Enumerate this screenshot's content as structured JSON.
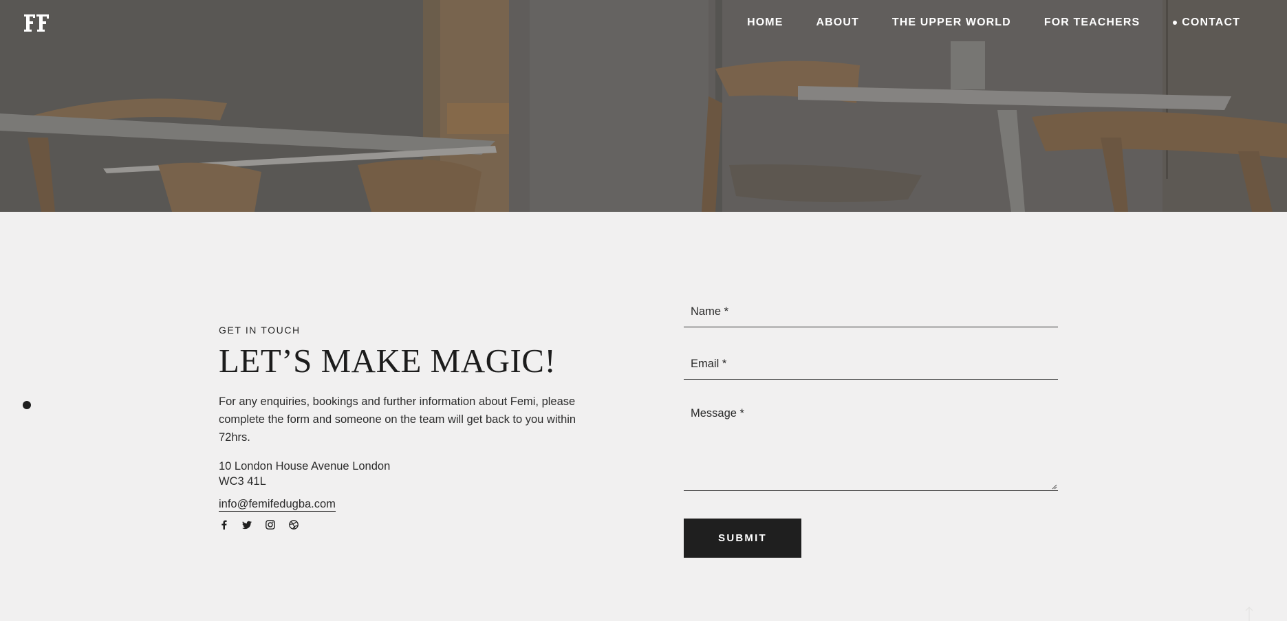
{
  "brand": {
    "logo_text": "FF"
  },
  "nav": {
    "items": [
      {
        "label": "HOME"
      },
      {
        "label": "ABOUT"
      },
      {
        "label": "THE UPPER WORLD"
      },
      {
        "label": "FOR TEACHERS"
      },
      {
        "label": "CONTACT",
        "active": true
      }
    ]
  },
  "contact": {
    "eyebrow": "GET IN TOUCH",
    "headline": "LET’S MAKE MAGIC!",
    "lede": "For any enquiries, bookings and further information about Femi, please complete the form and someone on the team will get back to you within 72hrs.",
    "address_line1": "10 London House Avenue London",
    "address_line2": "WC3 41L",
    "email": "info@femifedugba.com",
    "socials": [
      "facebook-icon",
      "twitter-icon",
      "instagram-icon",
      "dribbble-icon"
    ]
  },
  "form": {
    "name_placeholder": "Name *",
    "email_placeholder": "Email *",
    "message_placeholder": "Message *",
    "submit_label": "SUBMIT"
  },
  "colors": {
    "page_bg": "#f1f0f0",
    "text": "#1f1f1f",
    "button_bg": "#1f1f1f",
    "button_text": "#ffffff",
    "nav_text": "#ffffff"
  }
}
